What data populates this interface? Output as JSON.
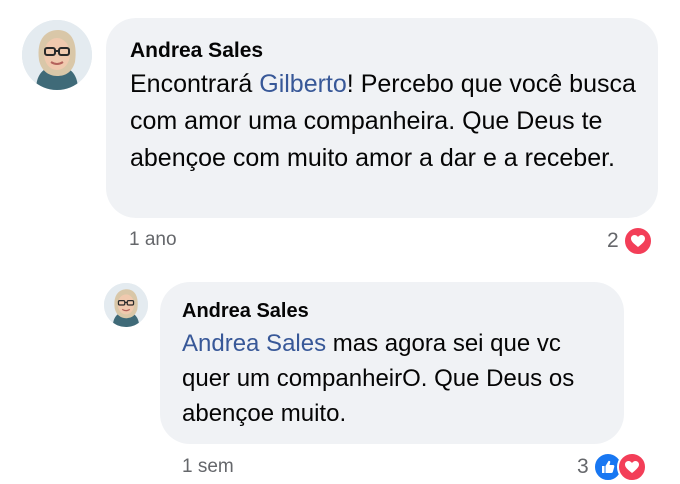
{
  "comment": {
    "author": "Andrea Sales",
    "text_mention": "Gilberto",
    "text_prefix": "Encontrará ",
    "text_suffix": "! Percebo que você busca com amor uma companheira. Que Deus te abençoe com muito amor a dar e a receber.",
    "time": "1 ano",
    "reaction_count": "2",
    "reactions": [
      "love-icon"
    ],
    "reply": {
      "author": "Andrea Sales",
      "text_mention": "Andrea Sales",
      "text_suffix": " mas agora sei que vc quer um companheirO. Que Deus os abençoe muito.",
      "time": "1 sem",
      "reaction_count": "3",
      "reactions": [
        "like-icon",
        "love-icon"
      ]
    }
  },
  "colors": {
    "bubble": "#f0f2f5",
    "mention": "#385898",
    "meta": "#65676b",
    "love": "#f33e58",
    "like": "#1877f2"
  }
}
